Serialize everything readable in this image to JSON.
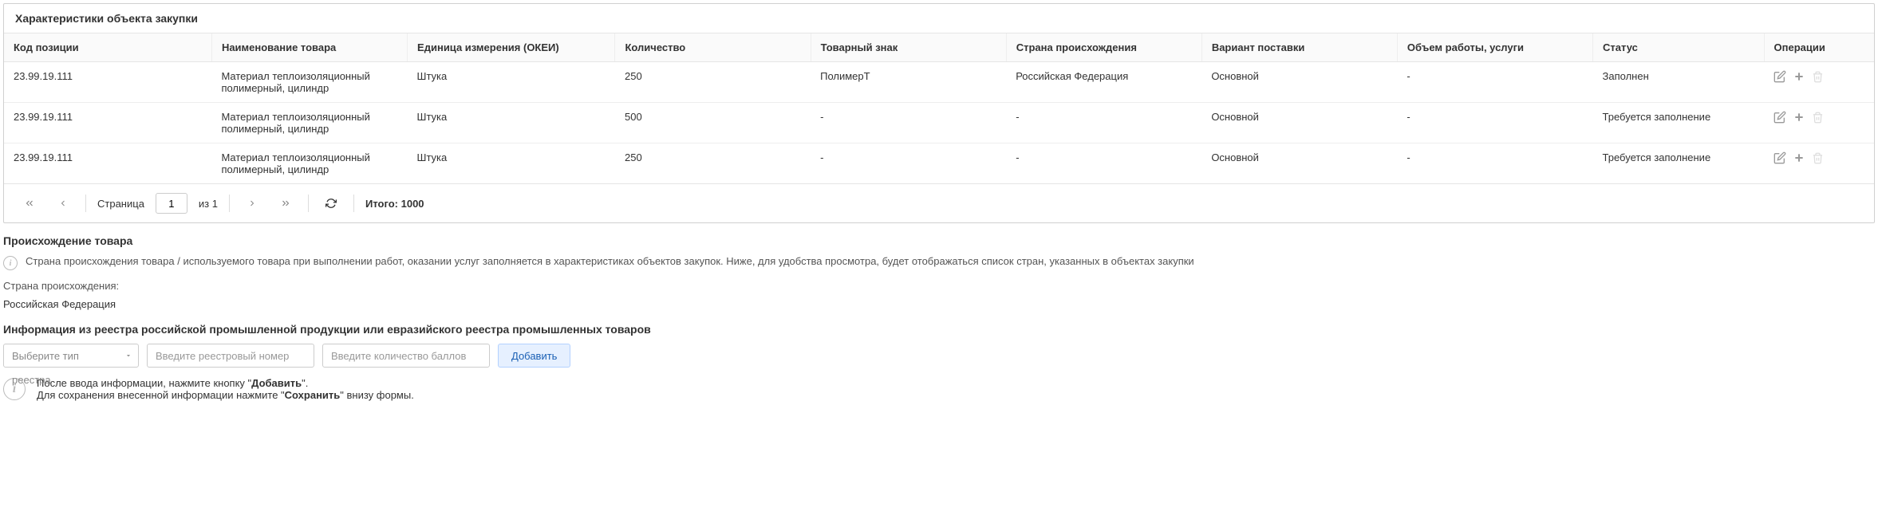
{
  "tablePanel": {
    "title": "Характеристики объекта закупки",
    "headers": {
      "code": "Код позиции",
      "name": "Наименование товара",
      "unit": "Единица измерения (ОКЕИ)",
      "qty": "Количество",
      "brand": "Товарный знак",
      "country": "Страна происхождения",
      "variant": "Вариант поставки",
      "volume": "Объем работы, услуги",
      "status": "Статус",
      "ops": "Операции"
    },
    "rows": [
      {
        "code": "23.99.19.111",
        "name": "Материал теплоизоляционный полимерный, цилиндр",
        "unit": "Штука",
        "qty": "250",
        "brand": "ПолимерТ",
        "country": "Российская Федерация",
        "variant": "Основной",
        "volume": "-",
        "status": "Заполнен"
      },
      {
        "code": "23.99.19.111",
        "name": "Материал теплоизоляционный полимерный, цилиндр",
        "unit": "Штука",
        "qty": "500",
        "brand": "-",
        "country": "-",
        "variant": "Основной",
        "volume": "-",
        "status": "Требуется заполнение"
      },
      {
        "code": "23.99.19.111",
        "name": "Материал теплоизоляционный полимерный, цилиндр",
        "unit": "Штука",
        "qty": "250",
        "brand": "-",
        "country": "-",
        "variant": "Основной",
        "volume": "-",
        "status": "Требуется заполнение"
      }
    ],
    "pager": {
      "pageLabel": "Страница",
      "pageValue": "1",
      "ofLabel": "из 1",
      "totalLabel": "Итого: 1000"
    }
  },
  "origin": {
    "title": "Происхождение товара",
    "infoText": "Страна происхождения товара / используемого товара при выполнении работ, оказании услуг заполняется в характеристиках объектов закупок. Ниже, для удобства просмотра, будет отображаться список стран, указанных в объектах закупки",
    "label": "Страна происхождения:",
    "value": "Российская Федерация"
  },
  "registry": {
    "title": "Информация из реестра российской промышленной продукции или евразийского реестра промышленных товаров",
    "selectPlaceholder": "Выберите тип реестра",
    "numberPlaceholder": "Введите реестровый номер",
    "pointsPlaceholder": "Введите количество баллов",
    "addButton": "Добавить",
    "hintLine1a": "После ввода информации, нажмите кнопку \"",
    "hintLine1bold": "Добавить",
    "hintLine1b": "\".",
    "hintLine2a": "Для сохранения внесенной информации нажмите \"",
    "hintLine2bold": "Сохранить",
    "hintLine2b": "\" внизу формы."
  }
}
